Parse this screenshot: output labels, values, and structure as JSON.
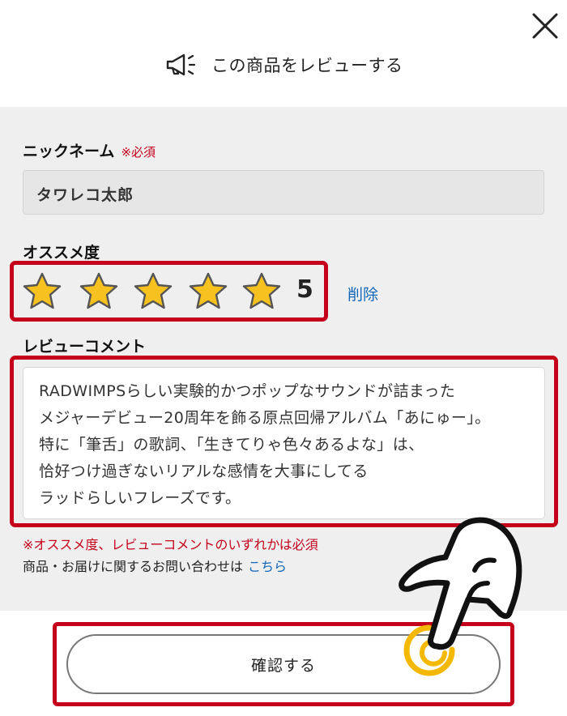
{
  "header": {
    "title": "この商品をレビューする",
    "icon": "megaphone-icon"
  },
  "close": {
    "icon": "close-icon"
  },
  "form": {
    "nickname": {
      "label": "ニックネーム",
      "required": "※必須",
      "value": "タワレコ太郎"
    },
    "rating": {
      "label": "オススメ度",
      "value": 5,
      "value_text": "5",
      "max": 5,
      "star_color": "#f7c21f",
      "delete_label": "削除"
    },
    "comment": {
      "label": "レビューコメント",
      "lines": [
        "RADWIMPSらしい実験的かつポップなサウンドが詰まった",
        "メジャーデビュー20周年を飾る原点回帰アルバム「あにゅー」。",
        "特に「筆舌」の歌詞、「生きてりゃ色々あるよな」は、",
        "恰好つけ過ぎないリアルな感情を大事にしてる",
        "ラッドらしいフレーズです。"
      ]
    },
    "note_required": "※オススメ度、レビューコメントのいずれかは必須",
    "inquiry": {
      "text": "商品・お届けに関するお問い合わせは",
      "link": "こちら"
    },
    "confirm_label": "確認する"
  },
  "colors": {
    "highlight": "#c4001b",
    "link": "#1066b8",
    "panel_bg": "#efefef",
    "tap_ring": "#f5b800"
  }
}
